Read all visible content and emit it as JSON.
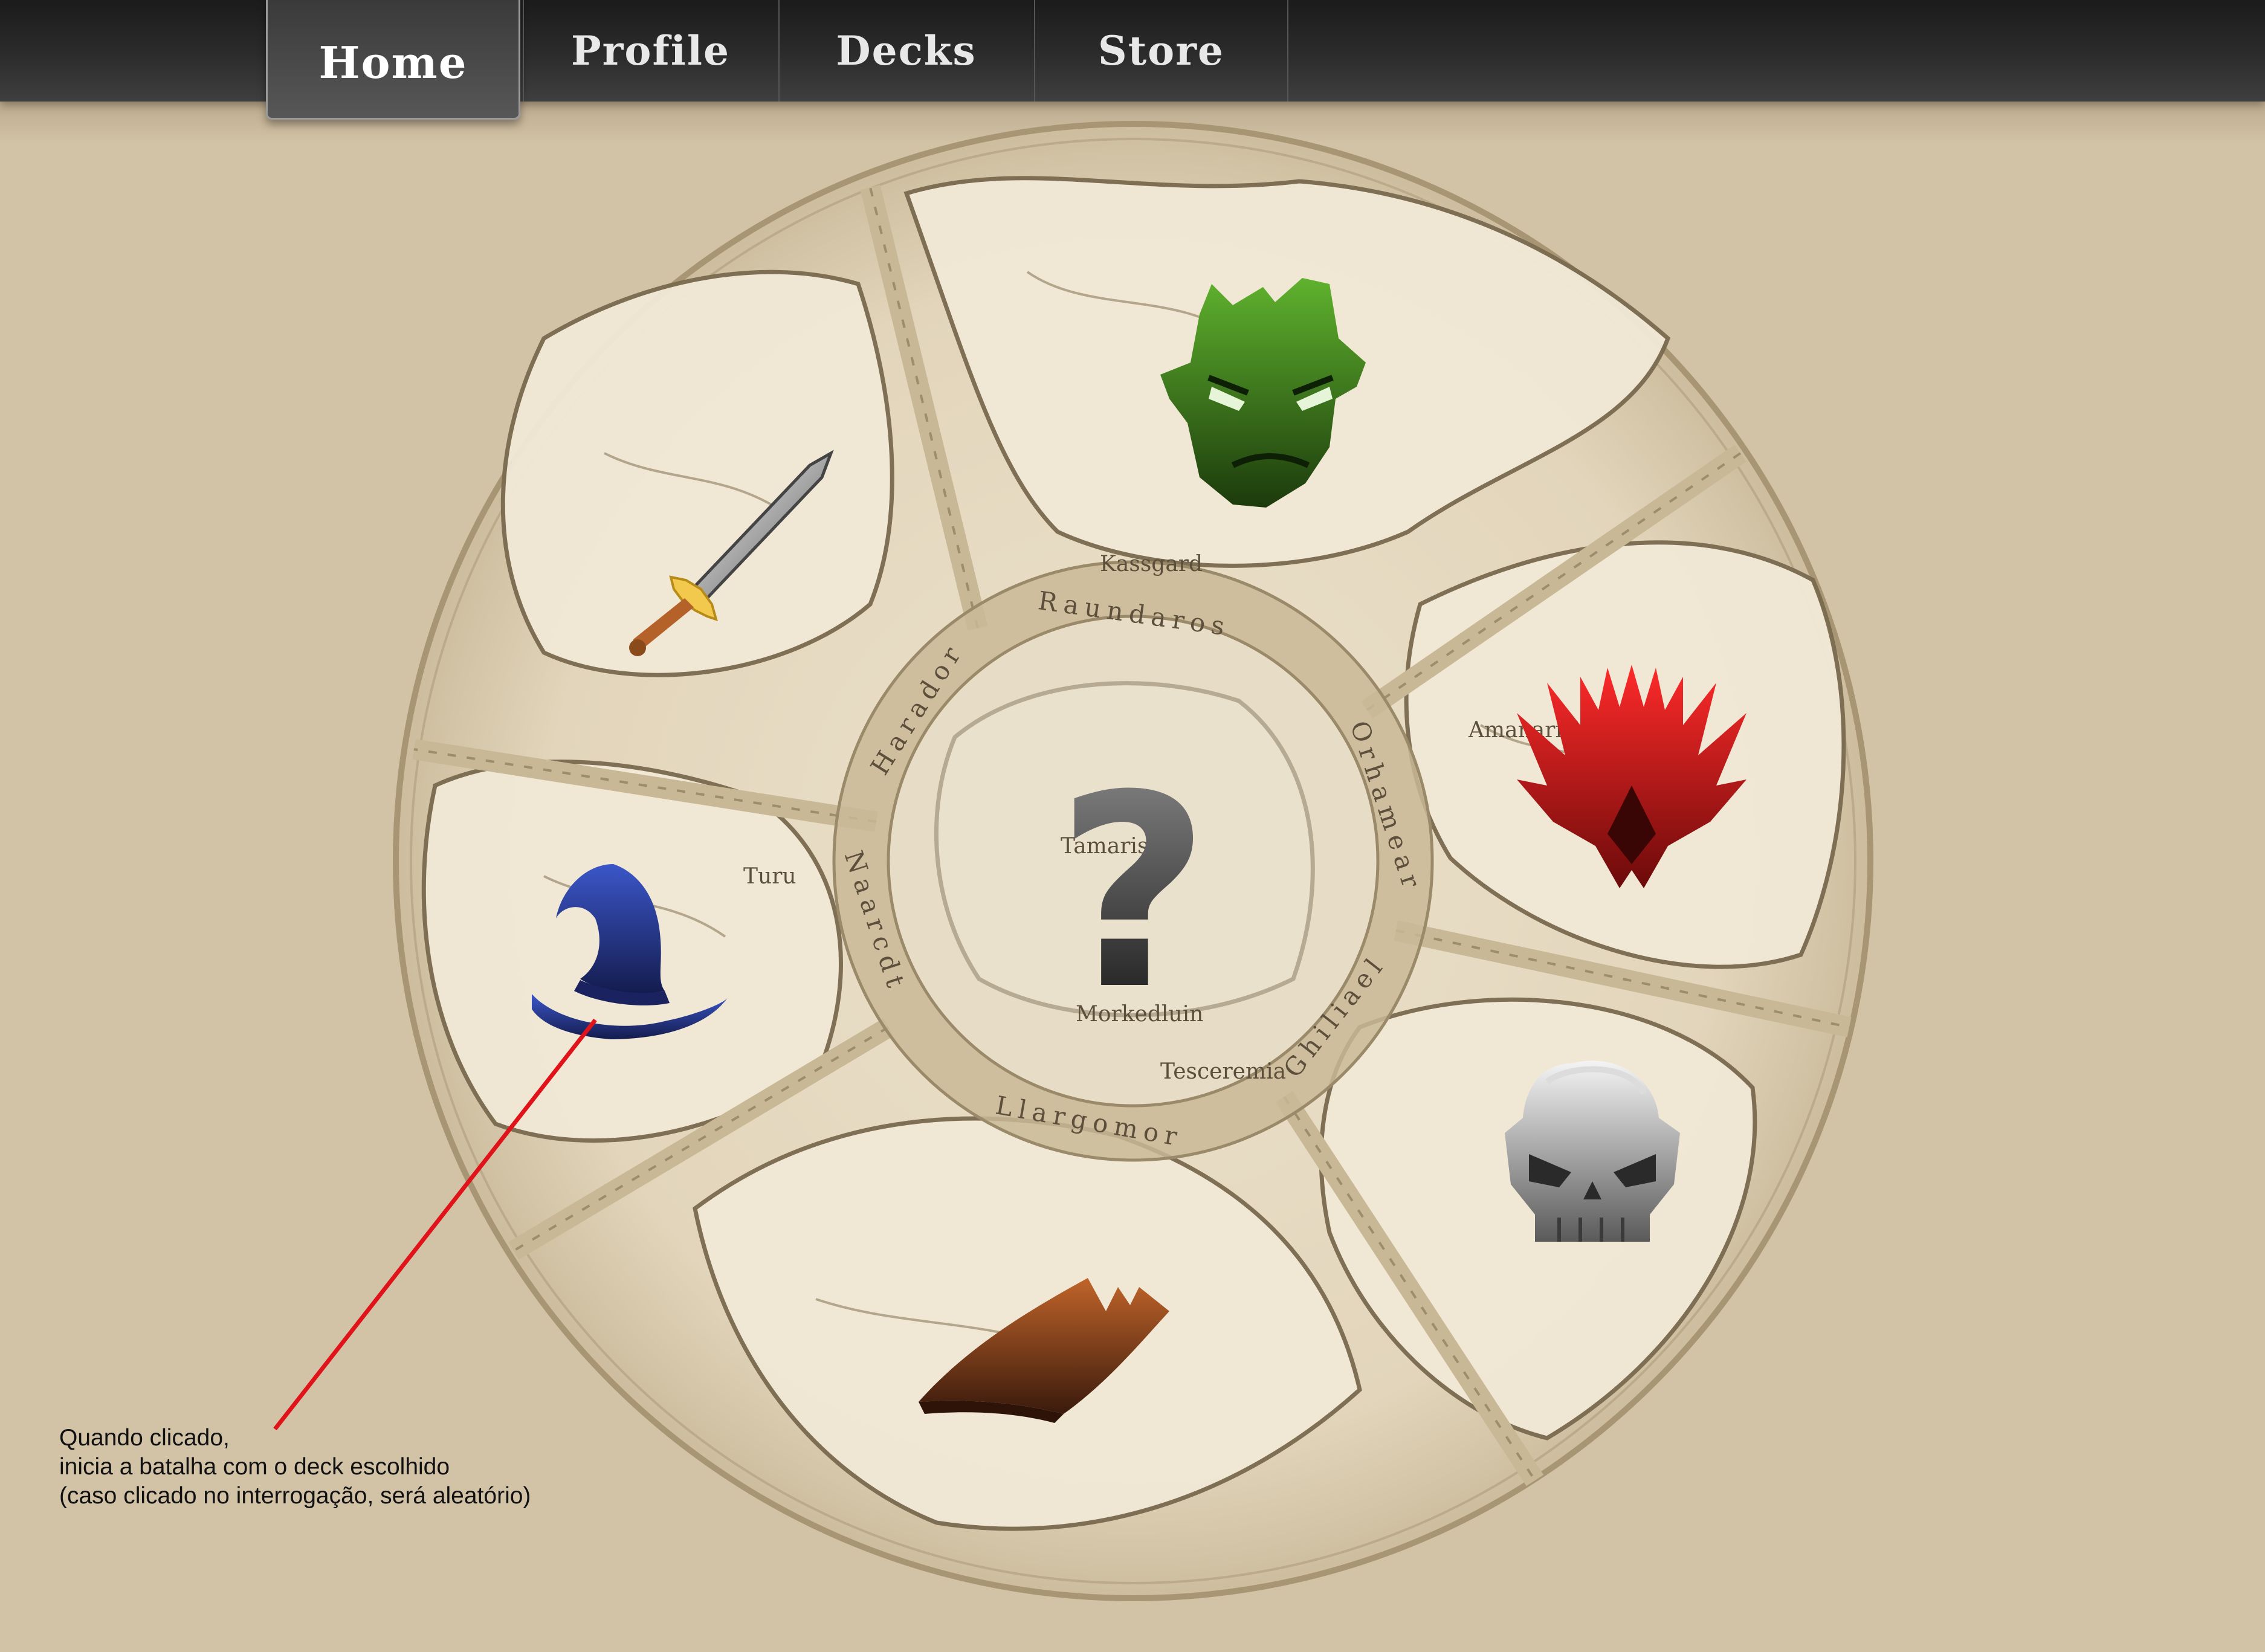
{
  "nav": {
    "tabs": [
      {
        "label": "Home",
        "active": true
      },
      {
        "label": "Profile",
        "active": false
      },
      {
        "label": "Decks",
        "active": false
      },
      {
        "label": "Store",
        "active": false
      }
    ]
  },
  "map": {
    "ring_labels": {
      "north": "Raundaros",
      "northwest": "Harador",
      "east": "Orhamear",
      "southeast": "Ghiliael",
      "south": "Llargomor",
      "west": "Naarcdt"
    },
    "place_names": {
      "kassgard": "Kassgard",
      "morkedluin": "Morkedluin",
      "tesceremia": "Tesceremia",
      "tamaris": "Tamaris",
      "amanarisil": "Amanarisil",
      "turu": "Turu"
    }
  },
  "decks": [
    {
      "name": "orc",
      "icon": "orc-head-icon",
      "color": "#3d8a1e"
    },
    {
      "name": "demon",
      "icon": "flame-crest-icon",
      "color": "#c4161c"
    },
    {
      "name": "undead",
      "icon": "skull-icon",
      "color": "#8a8a8a"
    },
    {
      "name": "arcane",
      "icon": "spellbook-icon",
      "color": "#a04a1e"
    },
    {
      "name": "mage",
      "icon": "wizard-hat-icon",
      "color": "#23338a"
    },
    {
      "name": "warrior",
      "icon": "sword-icon",
      "color": "#9a9a9a"
    },
    {
      "name": "random",
      "icon": "question-mark-icon",
      "color": "#3a3a3a"
    }
  ],
  "random_symbol": "?",
  "annotation": {
    "line1": "Quando clicado,",
    "line2": "inicia a batalha com o deck escolhido",
    "line3": "(caso clicado no interrogação, será aleatório)",
    "color": "#e0131a"
  }
}
